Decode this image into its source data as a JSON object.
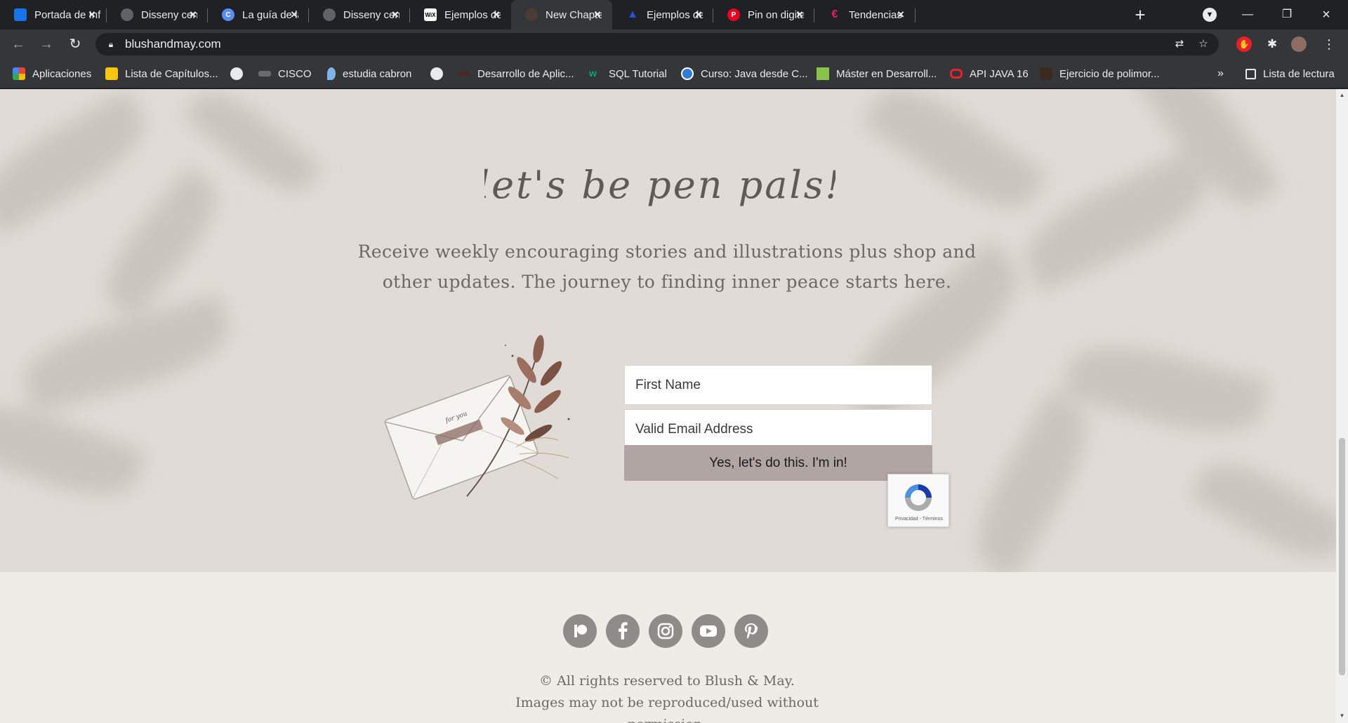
{
  "browser": {
    "tabs": [
      {
        "title": "Portada de Inf",
        "icon": "blue-doc-icon",
        "color": "#1a73e8"
      },
      {
        "title": "Disseny centra",
        "icon": "globe-icon",
        "color": "#9aa0a6"
      },
      {
        "title": "La guía de la je",
        "icon": "c-badge-icon",
        "color": "#5b8def"
      },
      {
        "title": "Disseny centra",
        "icon": "globe-icon",
        "color": "#9aa0a6"
      },
      {
        "title": "Ejemplos de cc",
        "icon": "wix-icon",
        "color": "#ffffff"
      },
      {
        "title": "New Chapter |",
        "icon": "site-favicon-icon",
        "color": "#4a3b36"
      },
      {
        "title": "Ejemplos de p",
        "icon": "graduation-cap-icon",
        "color": "#2b50d8"
      },
      {
        "title": "Pin on digital",
        "icon": "pinterest-icon",
        "color": "#e60023"
      },
      {
        "title": "Tendencias en",
        "icon": "pink-c-icon",
        "color": "#e91e63"
      }
    ],
    "active_tab_index": 5,
    "address": "blushandmay.com",
    "bookmarks": [
      {
        "label": "Aplicaciones",
        "icon": "apps-grid-icon",
        "color": "#e8710a"
      },
      {
        "label": "Lista de Capítulos...",
        "icon": "yellow-badge-icon",
        "color": "#f9c513"
      },
      {
        "label": "",
        "icon": "globe-icon",
        "color": "#e8eaed"
      },
      {
        "label": "CISCO",
        "icon": "cisco-icon",
        "color": "#6b6b6b"
      },
      {
        "label": "estudia cabron",
        "icon": "water-drop-icon",
        "color": "#7fb3e8"
      },
      {
        "label": "",
        "icon": "globe-icon",
        "color": "#e8eaed"
      },
      {
        "label": "Desarrollo de Aplic...",
        "icon": "dark-bar-icon",
        "color": "#4a2b24"
      },
      {
        "label": "SQL Tutorial",
        "icon": "w3-icon",
        "color": "#04aa6d"
      },
      {
        "label": "Curso: Java desde C...",
        "icon": "blue-circle-icon",
        "color": "#2f7bd9"
      },
      {
        "label": "Máster en Desarroll...",
        "icon": "green-square-icon",
        "color": "#8bc34a"
      },
      {
        "label": "API JAVA 16",
        "icon": "oracle-icon",
        "color": "#e5252a"
      },
      {
        "label": "Ejercicio de polimor...",
        "icon": "dark-avatar-icon",
        "color": "#3a2a20"
      }
    ],
    "bookmarks_overflow": "»",
    "reading_list": "Lista de lectura"
  },
  "signup": {
    "script_title": "let's be pen pals!",
    "lead": "Receive weekly encouraging stories and illustrations plus shop and other updates. The journey to finding inner peace starts here.",
    "envelope_note": "for you",
    "first_name_placeholder": "First Name",
    "email_placeholder": "Valid Email Address",
    "submit_label": "Yes, let's do this. I'm in!",
    "recaptcha_text": "Privacidad - Términos"
  },
  "footer": {
    "social_icons": [
      "patreon-icon",
      "facebook-icon",
      "instagram-icon",
      "youtube-icon",
      "pinterest-icon"
    ],
    "copyright_line1": "© All rights reserved to Blush & May.",
    "copyright_line2": "Images may not be reproduced/used without",
    "copyright_line3": "permission."
  },
  "colors": {
    "signup_bg": "#e0dbd6",
    "footer_bg": "#efece8",
    "button_bg": "#b1a5a4",
    "social_bg": "#8f8b88",
    "text_muted": "#6d6865"
  }
}
